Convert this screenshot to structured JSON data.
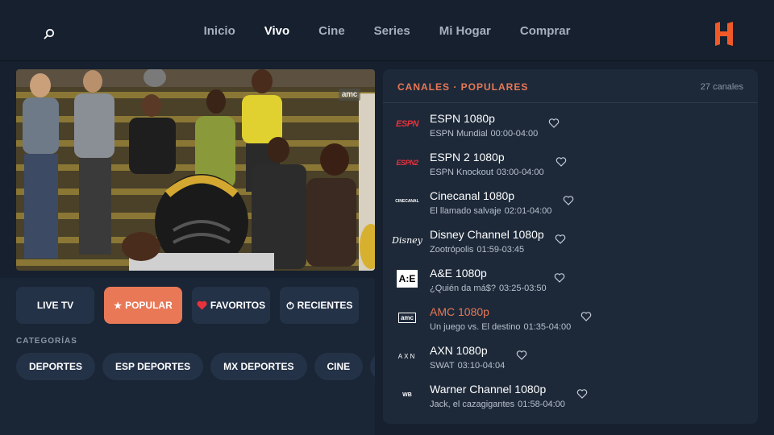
{
  "nav": {
    "items": [
      {
        "label": "Inicio",
        "active": false
      },
      {
        "label": "Vivo",
        "active": true
      },
      {
        "label": "Cine",
        "active": false
      },
      {
        "label": "Series",
        "active": false
      },
      {
        "label": "Mi Hogar",
        "active": false
      },
      {
        "label": "Comprar",
        "active": false
      }
    ],
    "logo_letter": "H"
  },
  "player": {
    "channel_bug": "amc"
  },
  "filters": [
    {
      "label": "LIVE TV",
      "icon": "",
      "active": false
    },
    {
      "label": "POPULAR",
      "icon": "star-icon",
      "active": true
    },
    {
      "label": "FAVORITOS",
      "icon": "heart-icon",
      "active": false
    },
    {
      "label": "RECIENTES",
      "icon": "clock-icon",
      "active": false
    }
  ],
  "categories": {
    "label": "CATEGORÍAS",
    "items": [
      "DEPORTES",
      "ESP DEPORTES",
      "MX DEPORTES",
      "CINE"
    ]
  },
  "channel_panel": {
    "title": "CANALES · POPULARES",
    "count": "27 canales",
    "channels": [
      {
        "name": "ESPN 1080p",
        "program": "ESPN Mundial",
        "time": "00:00-04:00",
        "logo": "ESPN",
        "active": false
      },
      {
        "name": "ESPN 2 1080p",
        "program": "ESPN Knockout",
        "time": "03:00-04:00",
        "logo": "ESPN2",
        "active": false
      },
      {
        "name": "Cinecanal 1080p",
        "program": "El llamado salvaje",
        "time": "02:01-04:00",
        "logo": "CINECANAL",
        "active": false
      },
      {
        "name": "Disney Channel 1080p",
        "program": "Zootrópolis",
        "time": "01:59-03:45",
        "logo": "Disney",
        "active": false
      },
      {
        "name": "A&E 1080p",
        "program": "¿Quién da má$?",
        "time": "03:25-03:50",
        "logo": "A:E",
        "active": false
      },
      {
        "name": "AMC 1080p",
        "program": "Un juego vs. El destino",
        "time": "01:35-04:00",
        "logo": "amc",
        "active": true
      },
      {
        "name": "AXN 1080p",
        "program": "SWAT",
        "time": "03:10-04:04",
        "logo": "AXN",
        "active": false
      },
      {
        "name": "Warner Channel 1080p",
        "program": "Jack, el cazagigantes",
        "time": "01:58-04:00",
        "logo": "WB",
        "active": false
      }
    ]
  },
  "colors": {
    "accent": "#e97856",
    "background": "#16202e",
    "panel": "#1d2939",
    "button": "#243247"
  }
}
